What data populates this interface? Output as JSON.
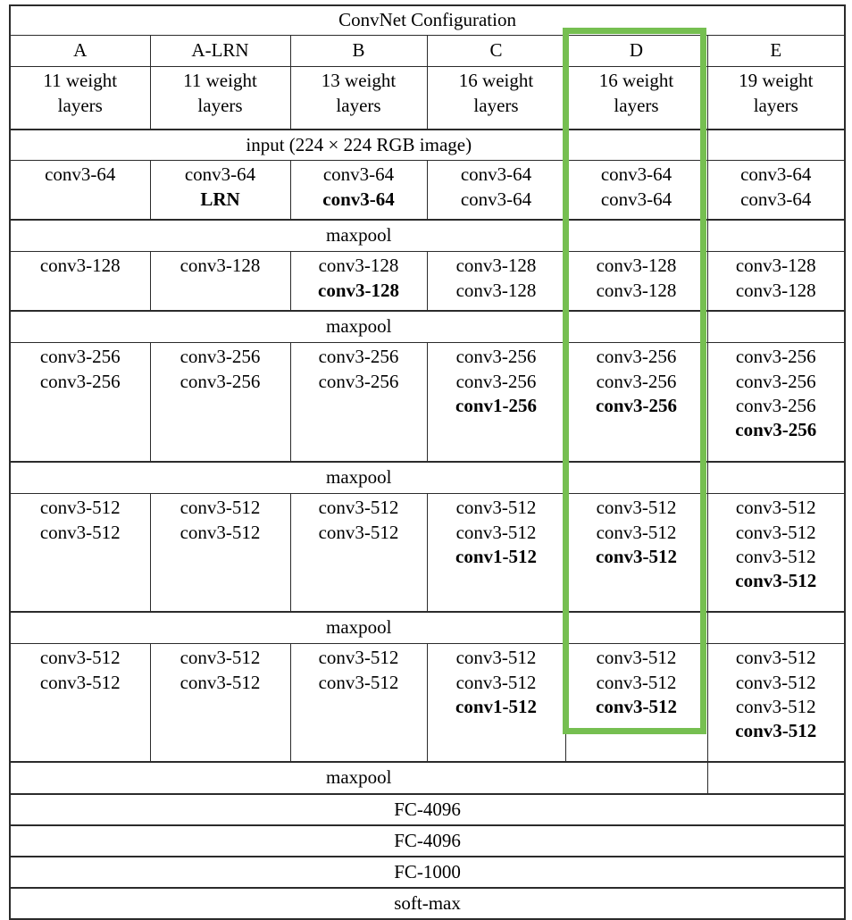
{
  "table": {
    "title": "ConvNet Configuration",
    "columns": [
      {
        "name": "A",
        "weights_line1": "11 weight",
        "weights_line2": "layers"
      },
      {
        "name": "A-LRN",
        "weights_line1": "11 weight",
        "weights_line2": "layers"
      },
      {
        "name": "B",
        "weights_line1": "13 weight",
        "weights_line2": "layers"
      },
      {
        "name": "C",
        "weights_line1": "16 weight",
        "weights_line2": "layers"
      },
      {
        "name": "D",
        "weights_line1": "16 weight",
        "weights_line2": "layers"
      },
      {
        "name": "E",
        "weights_line1": "19 weight",
        "weights_line2": "layers"
      }
    ],
    "input_row": "input (224 × 224 RGB image)",
    "maxpool_label": "maxpool",
    "blocks": [
      {
        "id": "block-64",
        "cells": [
          {
            "lines": [
              {
                "text": "conv3-64",
                "bold": false
              }
            ]
          },
          {
            "lines": [
              {
                "text": "conv3-64",
                "bold": false
              },
              {
                "text": "LRN",
                "bold": true
              }
            ]
          },
          {
            "lines": [
              {
                "text": "conv3-64",
                "bold": false
              },
              {
                "text": "conv3-64",
                "bold": true
              }
            ]
          },
          {
            "lines": [
              {
                "text": "conv3-64",
                "bold": false
              },
              {
                "text": "conv3-64",
                "bold": false
              }
            ]
          },
          {
            "lines": [
              {
                "text": "conv3-64",
                "bold": false
              },
              {
                "text": "conv3-64",
                "bold": false
              }
            ]
          },
          {
            "lines": [
              {
                "text": "conv3-64",
                "bold": false
              },
              {
                "text": "conv3-64",
                "bold": false
              }
            ]
          }
        ]
      },
      {
        "id": "block-128",
        "cells": [
          {
            "lines": [
              {
                "text": "conv3-128",
                "bold": false
              }
            ]
          },
          {
            "lines": [
              {
                "text": "conv3-128",
                "bold": false
              }
            ]
          },
          {
            "lines": [
              {
                "text": "conv3-128",
                "bold": false
              },
              {
                "text": "conv3-128",
                "bold": true
              }
            ]
          },
          {
            "lines": [
              {
                "text": "conv3-128",
                "bold": false
              },
              {
                "text": "conv3-128",
                "bold": false
              }
            ]
          },
          {
            "lines": [
              {
                "text": "conv3-128",
                "bold": false
              },
              {
                "text": "conv3-128",
                "bold": false
              }
            ]
          },
          {
            "lines": [
              {
                "text": "conv3-128",
                "bold": false
              },
              {
                "text": "conv3-128",
                "bold": false
              }
            ]
          }
        ]
      },
      {
        "id": "block-256",
        "cells": [
          {
            "lines": [
              {
                "text": "conv3-256",
                "bold": false
              },
              {
                "text": "conv3-256",
                "bold": false
              }
            ]
          },
          {
            "lines": [
              {
                "text": "conv3-256",
                "bold": false
              },
              {
                "text": "conv3-256",
                "bold": false
              }
            ]
          },
          {
            "lines": [
              {
                "text": "conv3-256",
                "bold": false
              },
              {
                "text": "conv3-256",
                "bold": false
              }
            ]
          },
          {
            "lines": [
              {
                "text": "conv3-256",
                "bold": false
              },
              {
                "text": "conv3-256",
                "bold": false
              },
              {
                "text": "conv1-256",
                "bold": true
              }
            ]
          },
          {
            "lines": [
              {
                "text": "conv3-256",
                "bold": false
              },
              {
                "text": "conv3-256",
                "bold": false
              },
              {
                "text": "conv3-256",
                "bold": true
              }
            ]
          },
          {
            "lines": [
              {
                "text": "conv3-256",
                "bold": false
              },
              {
                "text": "conv3-256",
                "bold": false
              },
              {
                "text": "conv3-256",
                "bold": false
              },
              {
                "text": "conv3-256",
                "bold": true
              }
            ]
          }
        ]
      },
      {
        "id": "block-512-a",
        "cells": [
          {
            "lines": [
              {
                "text": "conv3-512",
                "bold": false
              },
              {
                "text": "conv3-512",
                "bold": false
              }
            ]
          },
          {
            "lines": [
              {
                "text": "conv3-512",
                "bold": false
              },
              {
                "text": "conv3-512",
                "bold": false
              }
            ]
          },
          {
            "lines": [
              {
                "text": "conv3-512",
                "bold": false
              },
              {
                "text": "conv3-512",
                "bold": false
              }
            ]
          },
          {
            "lines": [
              {
                "text": "conv3-512",
                "bold": false
              },
              {
                "text": "conv3-512",
                "bold": false
              },
              {
                "text": "conv1-512",
                "bold": true
              }
            ]
          },
          {
            "lines": [
              {
                "text": "conv3-512",
                "bold": false
              },
              {
                "text": "conv3-512",
                "bold": false
              },
              {
                "text": "conv3-512",
                "bold": true
              }
            ]
          },
          {
            "lines": [
              {
                "text": "conv3-512",
                "bold": false
              },
              {
                "text": "conv3-512",
                "bold": false
              },
              {
                "text": "conv3-512",
                "bold": false
              },
              {
                "text": "conv3-512",
                "bold": true
              }
            ]
          }
        ]
      },
      {
        "id": "block-512-b",
        "cells": [
          {
            "lines": [
              {
                "text": "conv3-512",
                "bold": false
              },
              {
                "text": "conv3-512",
                "bold": false
              }
            ]
          },
          {
            "lines": [
              {
                "text": "conv3-512",
                "bold": false
              },
              {
                "text": "conv3-512",
                "bold": false
              }
            ]
          },
          {
            "lines": [
              {
                "text": "conv3-512",
                "bold": false
              },
              {
                "text": "conv3-512",
                "bold": false
              }
            ]
          },
          {
            "lines": [
              {
                "text": "conv3-512",
                "bold": false
              },
              {
                "text": "conv3-512",
                "bold": false
              },
              {
                "text": "conv1-512",
                "bold": true
              }
            ]
          },
          {
            "lines": [
              {
                "text": "conv3-512",
                "bold": false
              },
              {
                "text": "conv3-512",
                "bold": false
              },
              {
                "text": "conv3-512",
                "bold": true
              }
            ]
          },
          {
            "lines": [
              {
                "text": "conv3-512",
                "bold": false
              },
              {
                "text": "conv3-512",
                "bold": false
              },
              {
                "text": "conv3-512",
                "bold": false
              },
              {
                "text": "conv3-512",
                "bold": true
              }
            ]
          }
        ]
      }
    ],
    "footer_rows": [
      "FC-4096",
      "FC-4096",
      "FC-1000",
      "soft-max"
    ]
  },
  "highlight": {
    "column": "D",
    "color": "#76bf51"
  }
}
